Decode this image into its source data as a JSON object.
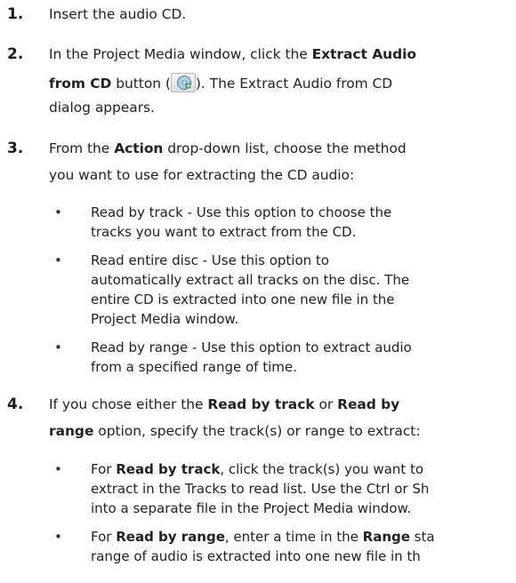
{
  "steps": [
    {
      "number": "1.",
      "text": "Insert the audio CD."
    },
    {
      "number": "2.",
      "line1_pre": "In the Project Media window, click the ",
      "line1_bold": "Extract Audio",
      "line2_bold": "from CD",
      "line2_pre": " button (",
      "icon": "extract-audio-from-cd-icon",
      "line2_post": "). The Extract Audio from CD",
      "line3": "dialog appears."
    },
    {
      "number": "3.",
      "line1_pre": "From the ",
      "line1_bold": "Action",
      "line1_post": " drop-down list, choose the method",
      "line2": "you want to use for extracting the CD audio:",
      "bullets": [
        {
          "lines": [
            "Read by track - Use this option to choose the",
            "tracks you want to extract from the CD."
          ]
        },
        {
          "lines": [
            "Read entire disc - Use this option to",
            "automatically extract all tracks on the disc. The",
            "entire CD is extracted into one new file in the",
            "Project Media window."
          ]
        },
        {
          "lines": [
            "Read by range - Use this option to extract audio",
            "from a specified range of time."
          ]
        }
      ]
    },
    {
      "number": "4.",
      "line1_pre": "If you chose either the ",
      "line1_bold1": "Read by track",
      "line1_mid": " or ",
      "line1_bold2": "Read by",
      "line2_bold": "range",
      "line2_post": " option, specify the track(s) or range to extract:",
      "bullets": [
        {
          "pre": "For ",
          "bold": "Read by track",
          "post": ", click the track(s) you want to",
          "line2": "extract in the Tracks to read list. Use the Ctrl or Sh",
          "line3": "into a separate file in the Project Media window."
        },
        {
          "pre": "For ",
          "bold": "Read by range",
          "mid": ", enter a time in the ",
          "bold2": "Range",
          "post": " sta",
          "line2": "range of audio is extracted into one new file in th"
        }
      ]
    }
  ]
}
